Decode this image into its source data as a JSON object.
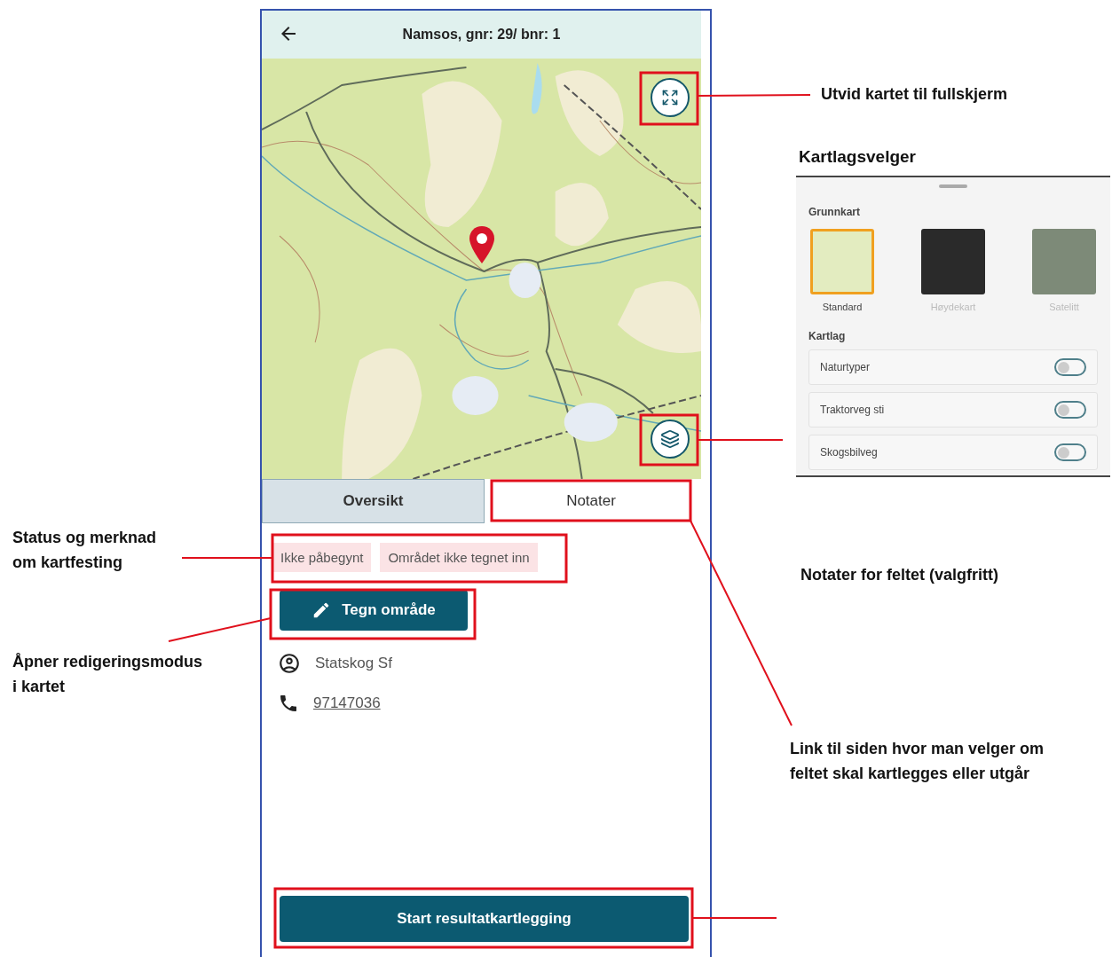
{
  "app": {
    "title": "Namsos, gnr: 29/ bnr: 1",
    "tabs": [
      {
        "label": "Oversikt",
        "selected": true
      },
      {
        "label": "Notater",
        "selected": false
      }
    ],
    "tags": [
      "Ikke påbegynt",
      "Området ikke tegnet inn"
    ],
    "draw_button": "Tegn område",
    "owner": "Statskog Sf",
    "phone": "97147036",
    "start_button": "Start resultatkartlegging"
  },
  "layer_picker": {
    "title": "Kartlagsvelger",
    "base_heading": "Grunnkart",
    "base_maps": [
      {
        "label": "Standard",
        "selected": true
      },
      {
        "label": "Høydekart",
        "selected": false
      },
      {
        "label": "Satelitt",
        "selected": false
      }
    ],
    "layers_heading": "Kartlag",
    "layers": [
      {
        "label": "Naturtyper",
        "on": false
      },
      {
        "label": "Traktorveg sti",
        "on": false
      },
      {
        "label": "Skogsbilveg",
        "on": false
      }
    ]
  },
  "annotations": {
    "left": [
      "Status og merknad\nom kartfesting",
      "Åpner redigeringsmodus\ni kartet"
    ],
    "right": [
      "Utvid kartet til fullskjerm",
      "Notater for feltet (valgfritt)",
      "Link til siden hvor man velger om\nfeltet skal kartlegges eller utgår"
    ]
  }
}
